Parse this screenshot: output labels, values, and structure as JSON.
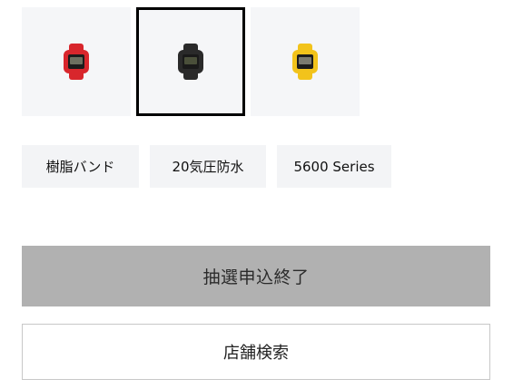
{
  "product_thumbnails": [
    {
      "icon": "watch-red-icon",
      "band_color": "#d8262c",
      "face_color": "#1c1c1c",
      "selected": false
    },
    {
      "icon": "watch-black-icon",
      "band_color": "#2a2a2a",
      "face_color": "#4a4f3a",
      "selected": true
    },
    {
      "icon": "watch-yellow-icon",
      "band_color": "#f2c31b",
      "face_color": "#1c1c1c",
      "selected": false
    }
  ],
  "tags": [
    {
      "label": "樹脂バンド"
    },
    {
      "label": "20気圧防水"
    },
    {
      "label": "5600 Series"
    }
  ],
  "actions": {
    "lottery_closed_label": "抽選申込終了",
    "store_search_label": "店舗検索"
  }
}
